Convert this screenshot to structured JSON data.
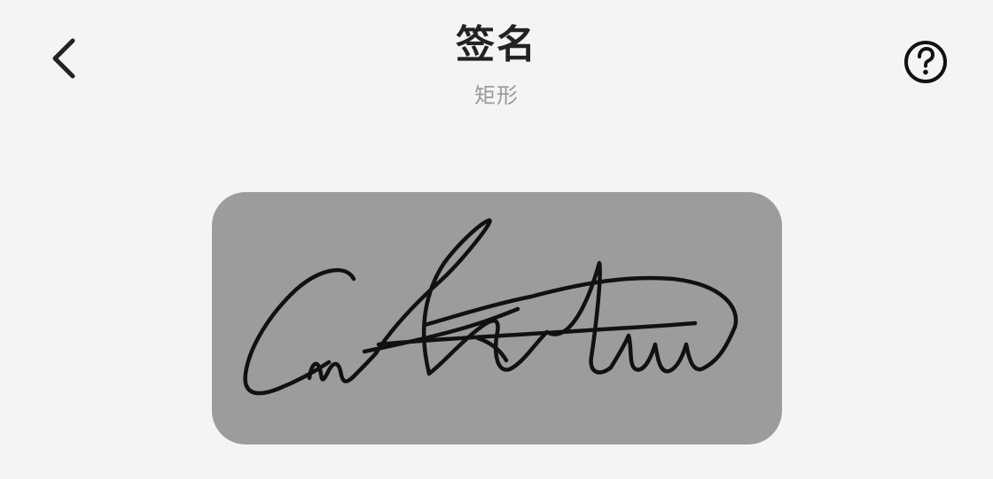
{
  "header": {
    "title": "签名",
    "subtitle": "矩形"
  },
  "icons": {
    "back": "chevron-left-icon",
    "help": "question-circle-icon"
  },
  "colors": {
    "background": "#f3f4f3",
    "signature_card": "#9c9c9c",
    "ink": "#111111"
  }
}
